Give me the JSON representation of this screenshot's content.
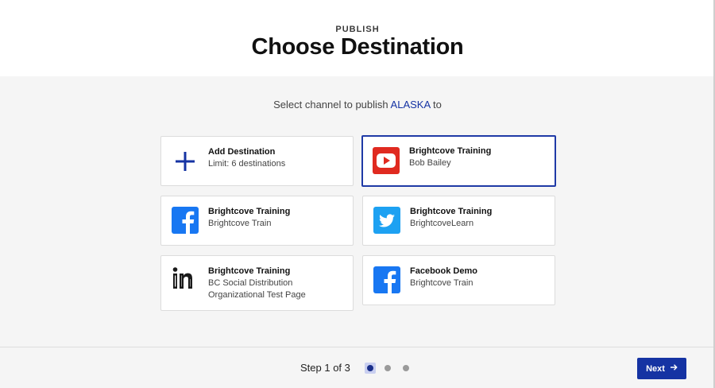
{
  "header": {
    "eyebrow": "PUBLISH",
    "title": "Choose Destination"
  },
  "prompt": {
    "before": "Select channel to publish ",
    "project": "ALASKA",
    "after": " to"
  },
  "destinations": [
    {
      "title": "Add Destination",
      "lines": [
        "Limit: 6 destinations"
      ],
      "icon": "plus-icon",
      "selected": false
    },
    {
      "title": "Brightcove Training",
      "lines": [
        "Bob Bailey"
      ],
      "icon": "youtube-icon",
      "selected": true
    },
    {
      "title": "Brightcove Training",
      "lines": [
        "Brightcove Train"
      ],
      "icon": "facebook-icon",
      "selected": false
    },
    {
      "title": "Brightcove Training",
      "lines": [
        "BrightcoveLearn"
      ],
      "icon": "twitter-icon",
      "selected": false
    },
    {
      "title": "Brightcove Training",
      "lines": [
        "BC Social Distribution",
        "Organizational Test Page"
      ],
      "icon": "linkedin-icon",
      "selected": false
    },
    {
      "title": "Facebook Demo",
      "lines": [
        "Brightcove Train"
      ],
      "icon": "facebook-icon",
      "selected": false
    }
  ],
  "footer": {
    "step_text": "Step 1 of 3",
    "current_step": 1,
    "total_steps": 3,
    "next_label": "Next"
  },
  "colors": {
    "accent": "#1533a3",
    "youtube": "#e02a20",
    "facebook": "#1877f2",
    "twitter": "#1da1f2"
  }
}
